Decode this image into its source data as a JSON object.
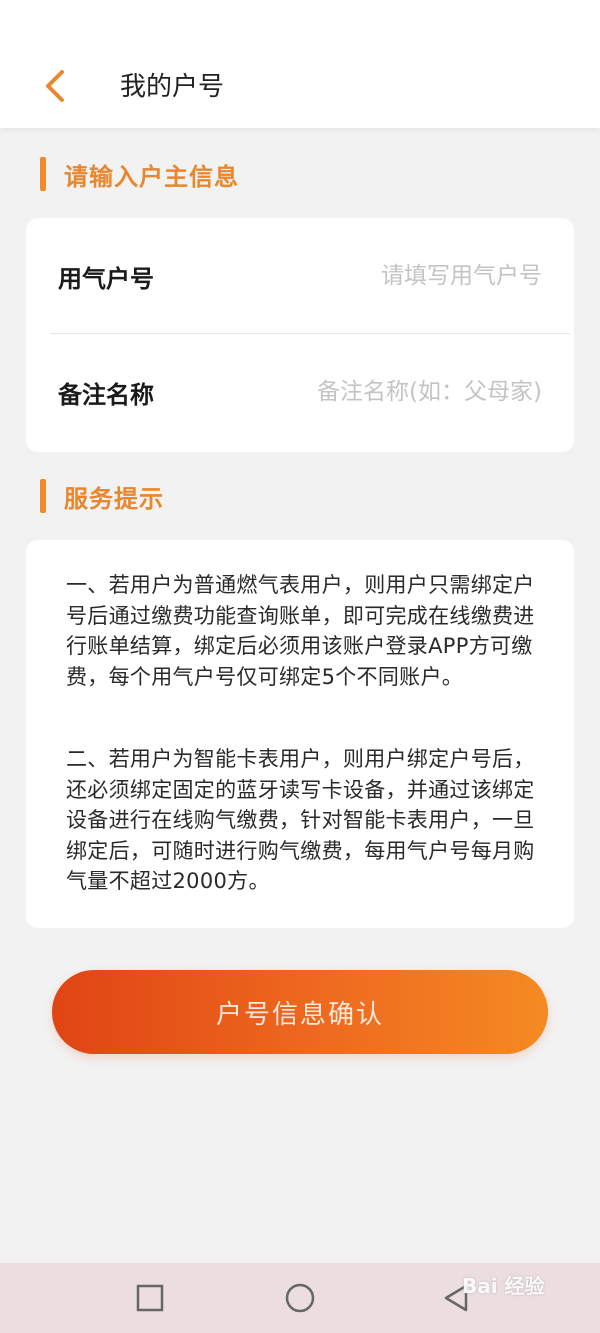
{
  "header": {
    "title": "我的户号",
    "back_icon": "chevron-left-icon"
  },
  "section_user_info": {
    "title": "请输入户主信息"
  },
  "form": {
    "gas_account": {
      "label": "用气户号",
      "placeholder": "请填写用气户号",
      "value": ""
    },
    "remark_name": {
      "label": "备注名称",
      "placeholder": "备注名称(如：父母家)",
      "value": ""
    }
  },
  "section_service_tips": {
    "title": "服务提示",
    "paragraphs": [
      "一、若用户为普通燃气表用户，则用户只需绑定户号后通过缴费功能查询账单，即可完成在线缴费进行账单结算，绑定后必须用该账户登录APP方可缴费，每个用气户号仅可绑定5个不同账户。",
      "二、若用户为智能卡表用户，则用户绑定户号后，还必须绑定固定的蓝牙读写卡设备，并通过该绑定设备进行在线购气缴费，针对智能卡表用户，一旦绑定后，可随时进行购气缴费，每用气户号每月购气量不超过2000方。"
    ]
  },
  "confirm_button": {
    "label": "户号信息确认"
  },
  "nav": {
    "recents_icon": "square-icon",
    "home_icon": "circle-icon",
    "back_icon": "triangle-back-icon"
  },
  "watermark": {
    "text": "Bai 经验"
  },
  "colors": {
    "accent": "#e8872e",
    "button_start": "#e04414",
    "button_end": "#f58a23",
    "nav_bg": "#ecdde0"
  }
}
